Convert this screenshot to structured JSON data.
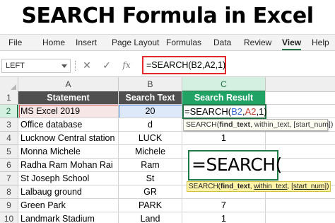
{
  "title": "SEARCH Formula in Excel",
  "ribbon": {
    "tabs": [
      "File",
      "Home",
      "Insert",
      "Page Layout",
      "Formulas",
      "Data",
      "Review",
      "View",
      "Help"
    ],
    "active_tab": "View"
  },
  "formula_bar": {
    "name_box": "LEFT",
    "cancel_icon": "✕",
    "enter_icon": "✓",
    "fx_label": "fx",
    "formula": "=SEARCH(B2,A2,1)"
  },
  "columns": [
    "A",
    "B",
    "C"
  ],
  "active_column": "C",
  "rows": [
    {
      "num": "1",
      "a": "Statement",
      "b": "Search Text",
      "c": "Search Result"
    },
    {
      "num": "2",
      "a": "MS Excel 2019",
      "b": "20",
      "c": ""
    },
    {
      "num": "3",
      "a": "Office database",
      "b": "d",
      "c": ""
    },
    {
      "num": "4",
      "a": "Lucknow Central station",
      "b": "LUCK",
      "c": "1"
    },
    {
      "num": "5",
      "a": "Monna Michele",
      "b": "Michele",
      "c": ""
    },
    {
      "num": "6",
      "a": "Radha Ram Mohan Rai",
      "b": "Ram",
      "c": ""
    },
    {
      "num": "7",
      "a": "St Joseph School",
      "b": "St",
      "c": ""
    },
    {
      "num": "8",
      "a": "Lalbaug ground",
      "b": "GR",
      "c": ""
    },
    {
      "num": "9",
      "a": "Green Park",
      "b": "PARK",
      "c": "7"
    },
    {
      "num": "10",
      "a": "Landmark Stadium",
      "b": "Land",
      "c": "1"
    }
  ],
  "active_row": "2",
  "editing": {
    "prefix": "=SEARCH(",
    "ref_b": "B2",
    "sep1": ",",
    "ref_a": "A2",
    "suffix": ",1)"
  },
  "tooltip_small": {
    "fn": "SEARCH(",
    "arg1": "find_text",
    "rest": ", within_text, [start_num])"
  },
  "zoom_formula": "=SEARCH(",
  "tooltip_large": {
    "fn": "SEARCH(",
    "arg1": "find_text",
    "sep": ", ",
    "arg2": "within_text",
    "sep2": ", ",
    "arg3": "[start_num]",
    "close": ")"
  },
  "colors": {
    "excel_green": "#217346",
    "header_dark": "#4f4f4f",
    "header_green": "#21a366",
    "formula_highlight": "#e5282b",
    "tooltip_yellow": "#fff3a8"
  }
}
